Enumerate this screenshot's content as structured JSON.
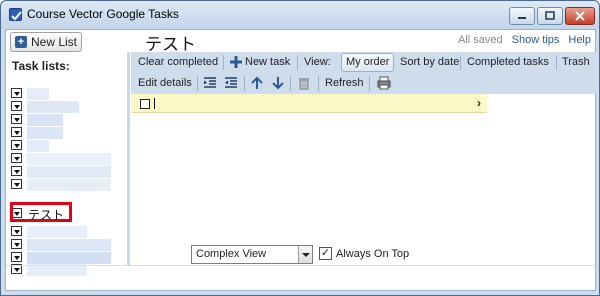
{
  "window": {
    "title": "Course Vector Google Tasks"
  },
  "header": {
    "new_list_label": "New List",
    "list_title": "テスト",
    "saved_status": "All saved",
    "show_tips": "Show tips",
    "help": "Help"
  },
  "sidebar": {
    "heading": "Task lists:",
    "selected_item_label": "テスト"
  },
  "toolbar": {
    "clear_completed": "Clear completed",
    "new_task": "New task",
    "view_label": "View:",
    "my_order": "My order",
    "sort_by_date": "Sort by date",
    "completed_tasks": "Completed tasks",
    "trash": "Trash",
    "edit_details": "Edit details",
    "refresh": "Refresh"
  },
  "footer": {
    "view_mode": "Complex View",
    "always_on_top_label": "Always On Top",
    "always_on_top_checked": "✓"
  }
}
